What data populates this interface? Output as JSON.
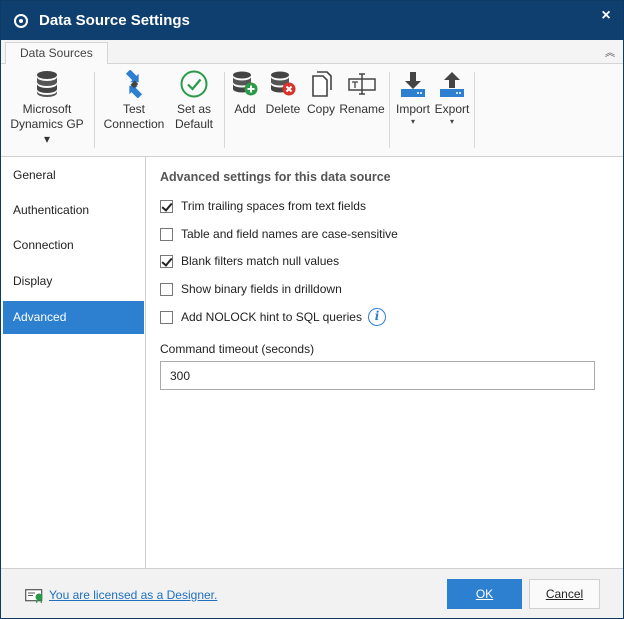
{
  "window": {
    "title": "Data Source Settings",
    "close_glyph": "×",
    "title_icon": "target-circle-icon"
  },
  "ribbon": {
    "tab_label": "Data Sources",
    "collapse_glyph": "︽",
    "buttons": {
      "datasource": {
        "line1": "Microsoft",
        "line2": "Dynamics GP ▾",
        "icon": "database-icon"
      },
      "test": {
        "line1": "Test",
        "line2": "Connection",
        "icon": "connection-arrows-icon"
      },
      "default": {
        "line1": "Set as",
        "line2": "Default",
        "icon": "checkmark-circle-icon"
      },
      "add": {
        "label": "Add",
        "icon": "database-add-icon"
      },
      "delete": {
        "label": "Delete",
        "icon": "database-delete-icon"
      },
      "copy": {
        "label": "Copy",
        "icon": "copy-icon"
      },
      "rename": {
        "label": "Rename",
        "icon": "rename-icon"
      },
      "import": {
        "label": "Import",
        "dropdown": "▾",
        "icon": "import-icon"
      },
      "export": {
        "label": "Export",
        "dropdown": "▾",
        "icon": "export-icon"
      }
    }
  },
  "sidebar": {
    "items": [
      {
        "label": "General"
      },
      {
        "label": "Authentication"
      },
      {
        "label": "Connection"
      },
      {
        "label": "Display"
      },
      {
        "label": "Advanced"
      }
    ],
    "active": "Advanced"
  },
  "content": {
    "section_title": "Advanced settings for this data source",
    "options": [
      {
        "label": "Trim trailing spaces from text fields",
        "checked": true
      },
      {
        "label": "Table and field names are case-sensitive",
        "checked": false
      },
      {
        "label": "Blank filters match null values",
        "checked": true
      },
      {
        "label": "Show binary fields in drilldown",
        "checked": false
      },
      {
        "label": "Add NOLOCK hint to SQL queries",
        "checked": false
      }
    ],
    "info_glyph": "i",
    "timeout_label": "Command timeout (seconds)",
    "timeout_value": "300"
  },
  "footer": {
    "license_text": "You are licensed as a Designer.",
    "license_icon": "certificate-icon",
    "ok_label": "OK",
    "cancel_label": "Cancel"
  },
  "colors": {
    "titlebar": "#0f3f6e",
    "accent": "#2d7fd0",
    "link": "#1f6fc0"
  }
}
